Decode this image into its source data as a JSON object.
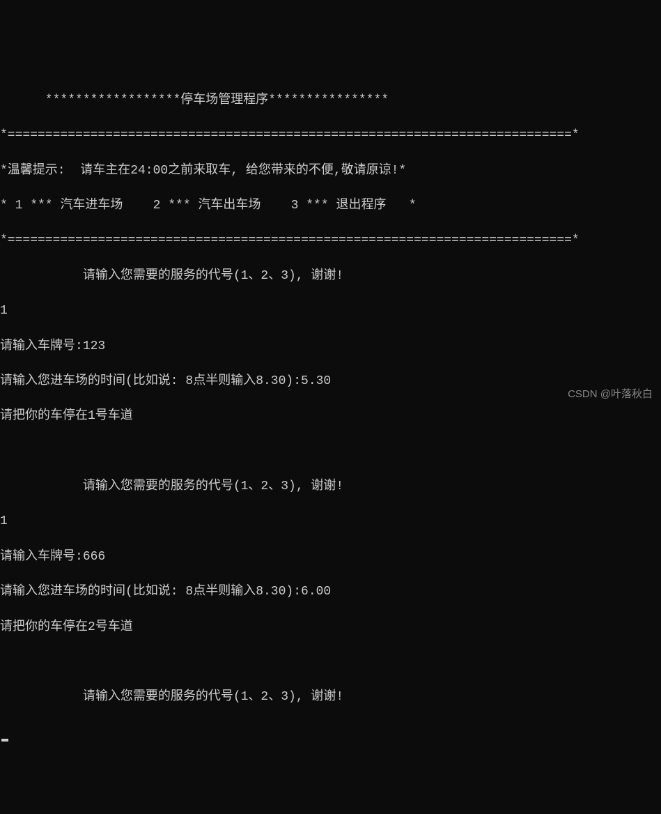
{
  "header": {
    "title_line": "      ******************停车场管理程序****************",
    "divider_top": "*===========================================================================*",
    "tip_line": "*温馨提示:  请车主在24:00之前来取车, 给您带来的不便,敬请原谅!*",
    "menu_line": "* 1 *** 汽车进车场    2 *** 汽车出车场    3 *** 退出程序   *",
    "divider_bottom": "*===========================================================================*"
  },
  "prompt_service": "           请输入您需要的服务的代号(1、2、3), 谢谢!",
  "session1": {
    "input_choice": "1",
    "plate_prompt": "请输入车牌号:",
    "plate_value": "123",
    "time_prompt": "请输入您进车场的时间(比如说: 8点半则输入8.30):",
    "time_value": "5.30",
    "park_result": "请把你的车停在1号车道"
  },
  "session2": {
    "input_choice": "1",
    "plate_prompt": "请输入车牌号:",
    "plate_value": "666",
    "time_prompt": "请输入您进车场的时间(比如说: 8点半则输入8.30):",
    "time_value": "6.00",
    "park_result": "请把你的车停在2号车道"
  },
  "watermark": "CSDN @叶落秋白"
}
